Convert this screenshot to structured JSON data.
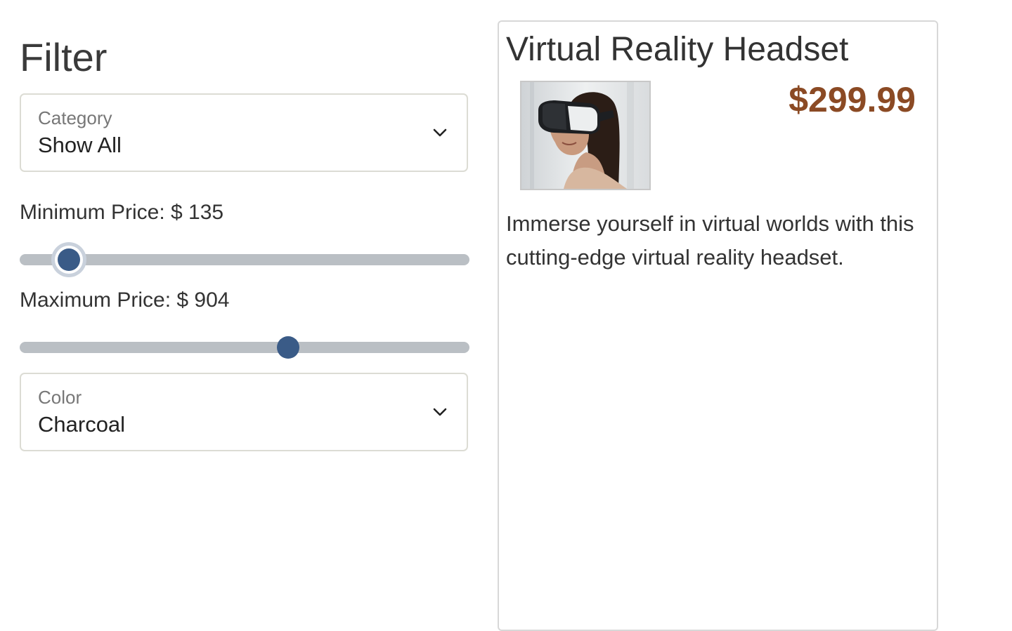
{
  "filter": {
    "title": "Filter",
    "category": {
      "label": "Category",
      "value": "Show All"
    },
    "min_price": {
      "label": "Minimum Price: $ 135",
      "value": 135,
      "fraction": 0.11
    },
    "max_price": {
      "label": "Maximum Price: $ 904",
      "value": 904,
      "fraction": 0.597
    },
    "color": {
      "label": "Color",
      "value": "Charcoal"
    }
  },
  "product": {
    "name": "Virtual Reality Headset",
    "price": "$299.99",
    "description": "Immerse yourself in virtual worlds with this cutting-edge virtual reality headset.",
    "image_alt": "woman wearing VR headset"
  },
  "colors": {
    "accent": "#3a5b87",
    "track": "#babfc4",
    "price": "#8b4a24",
    "border": "#dcdcd4"
  },
  "icons": {
    "dropdown": "chevron-down-icon"
  }
}
